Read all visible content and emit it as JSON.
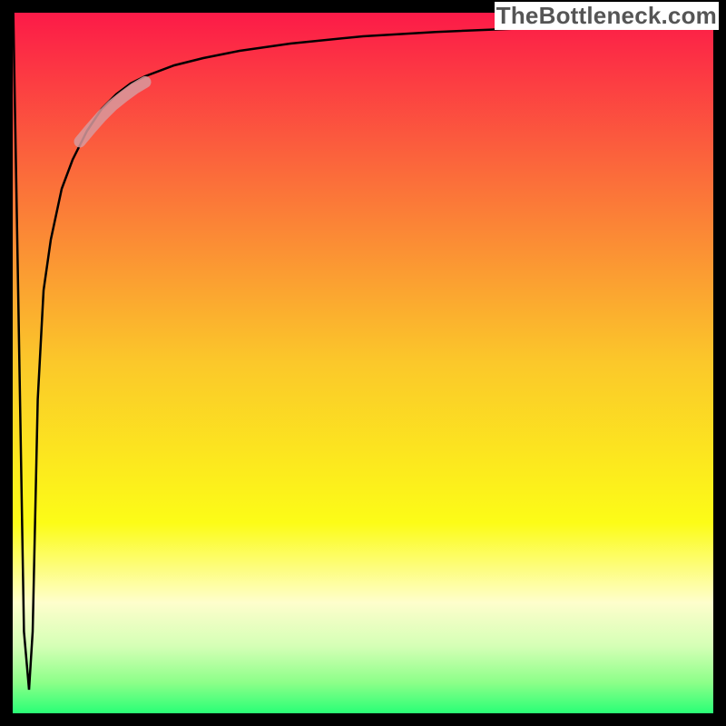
{
  "watermark": "TheBottleneck.com",
  "chart_data": {
    "type": "line",
    "title": "",
    "xlabel": "",
    "ylabel": "",
    "xlim": [
      0,
      100
    ],
    "ylim": [
      0,
      100
    ],
    "legend": false,
    "background_gradient": {
      "orientation": "vertical",
      "stops": [
        {
          "offset": 0.0,
          "color": "#fc1449"
        },
        {
          "offset": 0.25,
          "color": "#fb6f3a"
        },
        {
          "offset": 0.5,
          "color": "#fbc82a"
        },
        {
          "offset": 0.72,
          "color": "#fcfc17"
        },
        {
          "offset": 0.83,
          "color": "#fefecc"
        },
        {
          "offset": 0.89,
          "color": "#d5ffb6"
        },
        {
          "offset": 0.94,
          "color": "#8dff89"
        },
        {
          "offset": 1.0,
          "color": "#00ff6e"
        }
      ]
    },
    "frame": {
      "color": "#000000",
      "thickness_px": 14
    },
    "series": [
      {
        "name": "bottleneck-curve",
        "color": "#000000",
        "stroke_px": 2.5,
        "x": [
          1.8,
          2.5,
          3.3,
          4.0,
          4.5,
          5.2,
          6.0,
          7.0,
          8.5,
          10.0,
          12.0,
          14.0,
          16.0,
          18.0,
          20.0,
          24.0,
          28.0,
          33.0,
          40.0,
          50.0,
          60.0,
          72.0,
          85.0,
          97.0
        ],
        "values": [
          100,
          60,
          13,
          5.0,
          13,
          45,
          60,
          67,
          74,
          78,
          82,
          85,
          87,
          88.5,
          89.5,
          91,
          92,
          93,
          94,
          95,
          95.6,
          96.1,
          96.5,
          97.0
        ]
      },
      {
        "name": "highlight-band",
        "color": "#d79a9e",
        "stroke_px": 13,
        "opacity": 0.85,
        "x": [
          11.0,
          12.5,
          14.0,
          15.5,
          17.0,
          18.5,
          20.0
        ],
        "values": [
          80.5,
          82.3,
          84.0,
          85.5,
          86.7,
          87.8,
          88.7
        ]
      }
    ]
  }
}
